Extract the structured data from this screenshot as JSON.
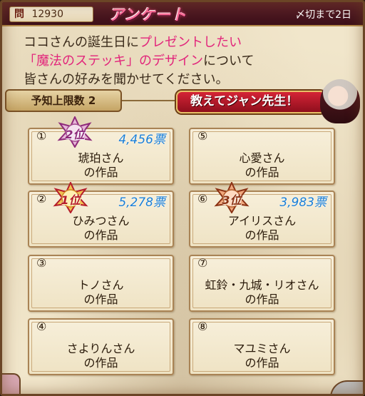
{
  "header": {
    "question_mark": "問",
    "question_number": "12930",
    "title": "アンケート",
    "deadline": "〆切まで2日"
  },
  "description": {
    "line1_a": "ココさんの誕生日に",
    "line1_b": "プレゼントしたい",
    "line2_a": "「魔法のステッキ」のデザイン",
    "line2_b": "について",
    "line3": "皆さんの好みを聞かせてください。"
  },
  "limit_label": "予知上限数 2",
  "teach_button_label": "教えてジャン先生！",
  "options": [
    {
      "num": "①",
      "name": "琥珀さん",
      "work": "の作品",
      "votes": "4,456票",
      "rank": "2位"
    },
    {
      "num": "②",
      "name": "ひみつさん",
      "work": "の作品",
      "votes": "5,278票",
      "rank": "1位"
    },
    {
      "num": "③",
      "name": "トノさん",
      "work": "の作品",
      "votes": "",
      "rank": ""
    },
    {
      "num": "④",
      "name": "さよりんさん",
      "work": "の作品",
      "votes": "",
      "rank": ""
    },
    {
      "num": "⑤",
      "name": "心愛さん",
      "work": "の作品",
      "votes": "",
      "rank": ""
    },
    {
      "num": "⑥",
      "name": "アイリスさん",
      "work": "の作品",
      "votes": "3,983票",
      "rank": "3位"
    },
    {
      "num": "⑦",
      "name": "虹鈴・九城・リオさん",
      "work": "の作品",
      "votes": "",
      "rank": ""
    },
    {
      "num": "⑧",
      "name": "マユミさん",
      "work": "の作品",
      "votes": "",
      "rank": ""
    }
  ],
  "colors": {
    "header_bg": "#4a1520",
    "title_pink": "#ff6f9c",
    "highlight_pink": "#e2257b",
    "votes_blue": "#1a7fd8",
    "button_red": "#c41c2e"
  },
  "icons": {
    "rank_badge": "star-badge-icon",
    "teacher_avatar": "teacher-avatar-icon"
  }
}
